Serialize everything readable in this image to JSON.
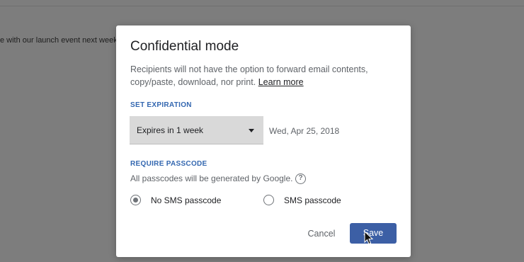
{
  "background": {
    "email_body_text": "e with our launch event next week."
  },
  "dialog": {
    "title": "Confidential mode",
    "description_line1": "Recipients will not have the option to forward email contents,",
    "description_line2": "copy/paste, download, nor print.",
    "learn_more": "Learn more",
    "expiration": {
      "section_label": "SET EXPIRATION",
      "selected_option": "Expires in 1 week",
      "expiry_date": "Wed, Apr 25, 2018"
    },
    "passcode": {
      "section_label": "REQUIRE PASSCODE",
      "note": "All passcodes will be generated by Google.",
      "help_glyph": "?",
      "options": [
        {
          "label": "No SMS passcode",
          "selected": true
        },
        {
          "label": "SMS passcode",
          "selected": false
        }
      ]
    },
    "actions": {
      "cancel": "Cancel",
      "save": "Save"
    }
  },
  "colors": {
    "overlay": "#7d7d7d",
    "accent_label": "#3367b0",
    "save_button": "#3c5fa5",
    "select_background": "#d9d9d9"
  },
  "icons": {
    "dropdown": "caret-down-icon",
    "help": "help-circle-icon",
    "cursor": "mouse-pointer-icon"
  }
}
